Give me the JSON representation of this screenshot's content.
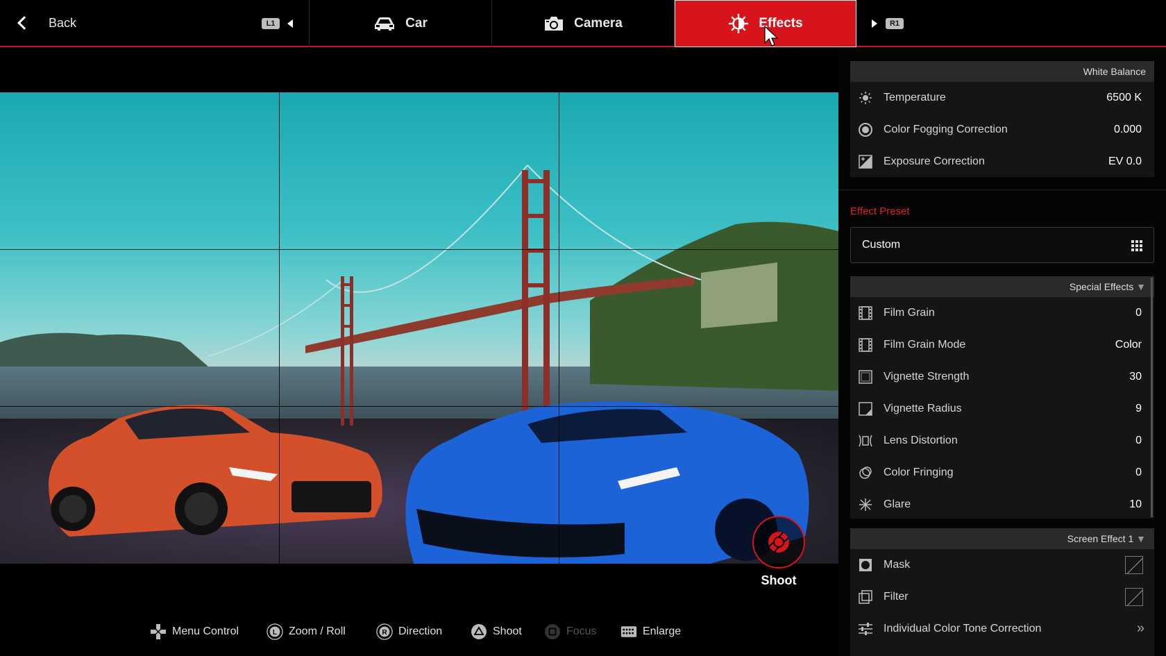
{
  "nav": {
    "back_label": "Back",
    "left_shoulder": "L1",
    "right_shoulder": "R1",
    "tabs": [
      {
        "label": "Car",
        "icon": "car-icon",
        "active": false
      },
      {
        "label": "Camera",
        "icon": "camera-icon",
        "active": false
      },
      {
        "label": "Effects",
        "icon": "brightness-icon",
        "active": true
      }
    ]
  },
  "shoot_label": "Shoot",
  "white_balance": {
    "header": "White Balance",
    "rows": [
      {
        "label": "Temperature",
        "value": "6500 K",
        "icon": "sun-icon"
      },
      {
        "label": "Color Fogging Correction",
        "value": "0.000",
        "icon": "fog-icon"
      },
      {
        "label": "Exposure Correction",
        "value": "EV 0.0",
        "icon": "exposure-icon"
      }
    ]
  },
  "effect_preset": {
    "title": "Effect Preset",
    "value": "Custom"
  },
  "special_effects": {
    "header": "Special Effects",
    "rows": [
      {
        "label": "Film Grain",
        "value": "0",
        "icon": "film-icon"
      },
      {
        "label": "Film Grain Mode",
        "value": "Color",
        "icon": "film-icon"
      },
      {
        "label": "Vignette Strength",
        "value": "30",
        "icon": "vignette-icon"
      },
      {
        "label": "Vignette Radius",
        "value": "9",
        "icon": "vignette-radius-icon"
      },
      {
        "label": "Lens Distortion",
        "value": "0",
        "icon": "lens-distortion-icon"
      },
      {
        "label": "Color Fringing",
        "value": "0",
        "icon": "color-fringing-icon"
      },
      {
        "label": "Glare",
        "value": "10",
        "icon": "glare-icon"
      }
    ]
  },
  "screen_effect": {
    "header": "Screen Effect 1",
    "rows": [
      {
        "label": "Mask",
        "icon": "mask-icon"
      },
      {
        "label": "Filter",
        "icon": "filter-icon"
      },
      {
        "label": "Individual Color Tone Correction",
        "icon": "sliders-icon"
      }
    ]
  },
  "hints": [
    {
      "label": "Menu Control",
      "icon": "dpad-icon"
    },
    {
      "label": "Zoom / Roll",
      "icon": "l-stick-icon"
    },
    {
      "label": "Direction",
      "icon": "r-stick-icon"
    },
    {
      "label": "Shoot",
      "icon": "triangle-button-icon"
    },
    {
      "label": "Focus",
      "icon": "square-button-icon"
    },
    {
      "label": "Enlarge",
      "icon": "touchpad-icon"
    }
  ]
}
